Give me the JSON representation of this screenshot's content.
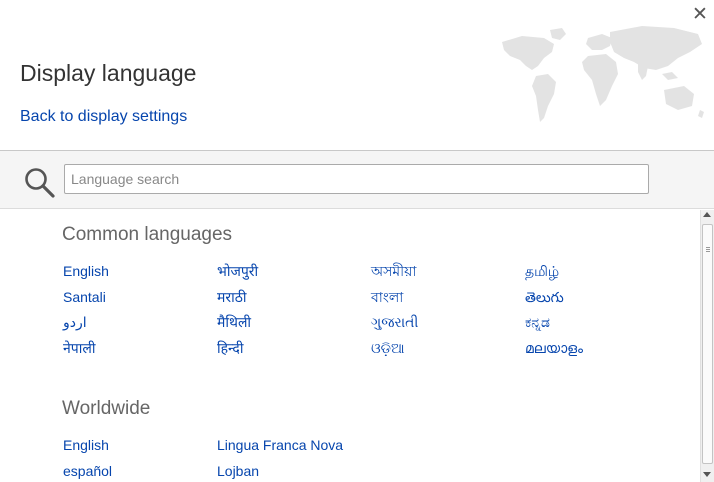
{
  "dialog": {
    "title": "Display language",
    "back_link": "Back to display settings",
    "close_glyph": "✕"
  },
  "search": {
    "placeholder": "Language search",
    "value": "",
    "icon": "search-icon"
  },
  "sections": {
    "common": {
      "title": "Common languages",
      "languages": [
        "English",
        "भोजपुरी",
        "অসমীয়া",
        "தமிழ்",
        "Santali",
        "मराठी",
        "বাংলা",
        "తెలుగు",
        "اردو",
        "मैथिली",
        "ગુજરાતી",
        "ಕನ್ನಡ",
        "नेपाली",
        "हिन्दी",
        "ଓଡ଼ିଆ",
        "മലയാളം"
      ]
    },
    "worldwide": {
      "title": "Worldwide",
      "languages": [
        "English",
        "Lingua Franca Nova",
        "español",
        "Lojban"
      ]
    }
  },
  "colors": {
    "link": "#0645ad",
    "section_title": "#666666",
    "search_band": "#f5f5f5",
    "map": "#e3e3e3"
  }
}
